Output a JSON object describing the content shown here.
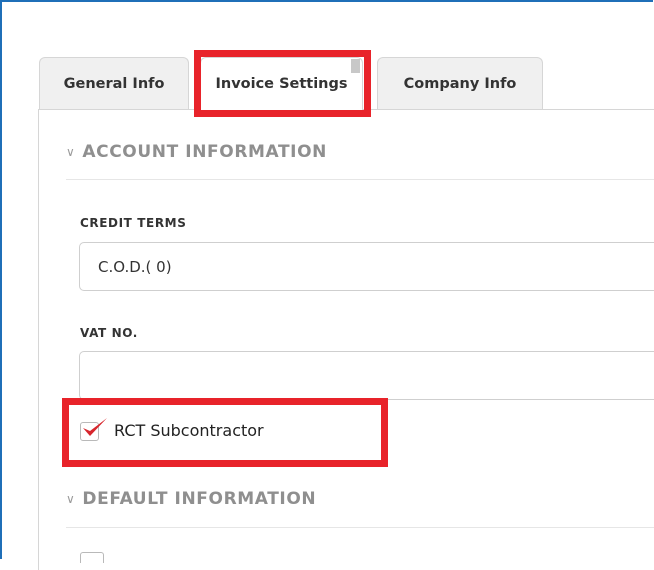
{
  "tabs": {
    "general": "General Info",
    "invoice": "Invoice Settings",
    "company": "Company Info"
  },
  "sections": {
    "account": "ACCOUNT INFORMATION",
    "default": "DEFAULT INFORMATION"
  },
  "fields": {
    "credit_terms_label": "CREDIT TERMS",
    "credit_terms_value": "C.O.D.( 0)",
    "vat_label": "VAT NO.",
    "vat_value": ""
  },
  "checkbox": {
    "label": "RCT Subcontractor",
    "checked": true
  },
  "colors": {
    "highlight": "#e8232a",
    "check": "#d7262d",
    "frame": "#1f6fb8"
  },
  "icons": {
    "section_toggle": "chevron-down-icon",
    "check": "checkmark-icon"
  }
}
